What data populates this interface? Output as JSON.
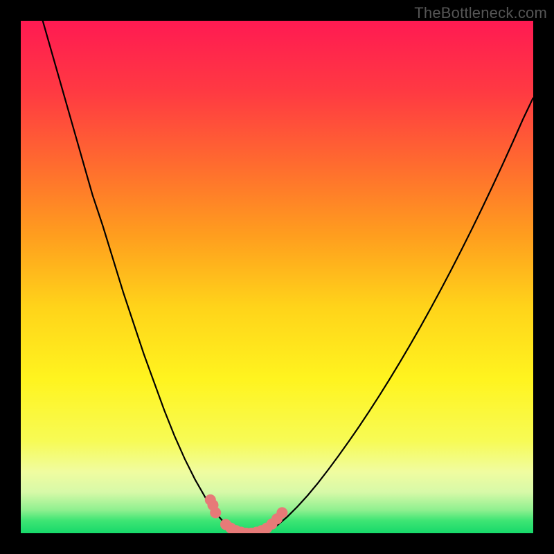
{
  "watermark": "TheBottleneck.com",
  "chart_data": {
    "type": "line",
    "title": "",
    "xlabel": "",
    "ylabel": "",
    "xlim": [
      0,
      100
    ],
    "ylim": [
      0,
      100
    ],
    "series": [
      {
        "name": "bottleneck-curve",
        "x": [
          0,
          2,
          4,
          6,
          8,
          10,
          12,
          14,
          16,
          18,
          20,
          22,
          24,
          26,
          28,
          30,
          32,
          34,
          36,
          38,
          40,
          42,
          44,
          46,
          48,
          50,
          52,
          54,
          56,
          58,
          60,
          62,
          64,
          66,
          68,
          70,
          72,
          74,
          76,
          78,
          80,
          82,
          84,
          86,
          88,
          90,
          92,
          94,
          96,
          98,
          100
        ],
        "values": [
          115,
          108,
          101,
          94,
          87,
          80,
          73,
          66,
          60,
          53.5,
          47,
          41,
          35,
          29.5,
          24,
          19,
          14.5,
          10.5,
          7,
          4,
          1.7,
          0.5,
          0,
          0,
          0.5,
          1.5,
          3.2,
          5.2,
          7.4,
          9.8,
          12.4,
          15.1,
          17.9,
          20.8,
          23.8,
          26.9,
          30.1,
          33.4,
          36.8,
          40.3,
          43.9,
          47.6,
          51.4,
          55.3,
          59.3,
          63.4,
          67.6,
          71.9,
          76.3,
          80.8,
          85
        ]
      }
    ],
    "markers": {
      "name": "highlight-points",
      "color": "#e77a78",
      "x": [
        37,
        37.5,
        38,
        40,
        41,
        42,
        43,
        44,
        45,
        46,
        47,
        48,
        49,
        50,
        51
      ],
      "y": [
        6.5,
        5.5,
        4,
        1.7,
        1.0,
        0.5,
        0.2,
        0,
        0,
        0.2,
        0.5,
        1.0,
        1.8,
        2.8,
        4.0
      ]
    },
    "background": {
      "type": "vertical-gradient",
      "stops": [
        {
          "pos": 0.0,
          "color": "#ff1a52"
        },
        {
          "pos": 0.14,
          "color": "#ff3a42"
        },
        {
          "pos": 0.28,
          "color": "#ff6b2f"
        },
        {
          "pos": 0.42,
          "color": "#ff9e1e"
        },
        {
          "pos": 0.56,
          "color": "#ffd41a"
        },
        {
          "pos": 0.7,
          "color": "#fff41f"
        },
        {
          "pos": 0.82,
          "color": "#f7fb55"
        },
        {
          "pos": 0.88,
          "color": "#f0fca0"
        },
        {
          "pos": 0.92,
          "color": "#d7f9a8"
        },
        {
          "pos": 0.955,
          "color": "#8ef08f"
        },
        {
          "pos": 0.975,
          "color": "#3fe574"
        },
        {
          "pos": 1.0,
          "color": "#16d96a"
        }
      ]
    }
  }
}
